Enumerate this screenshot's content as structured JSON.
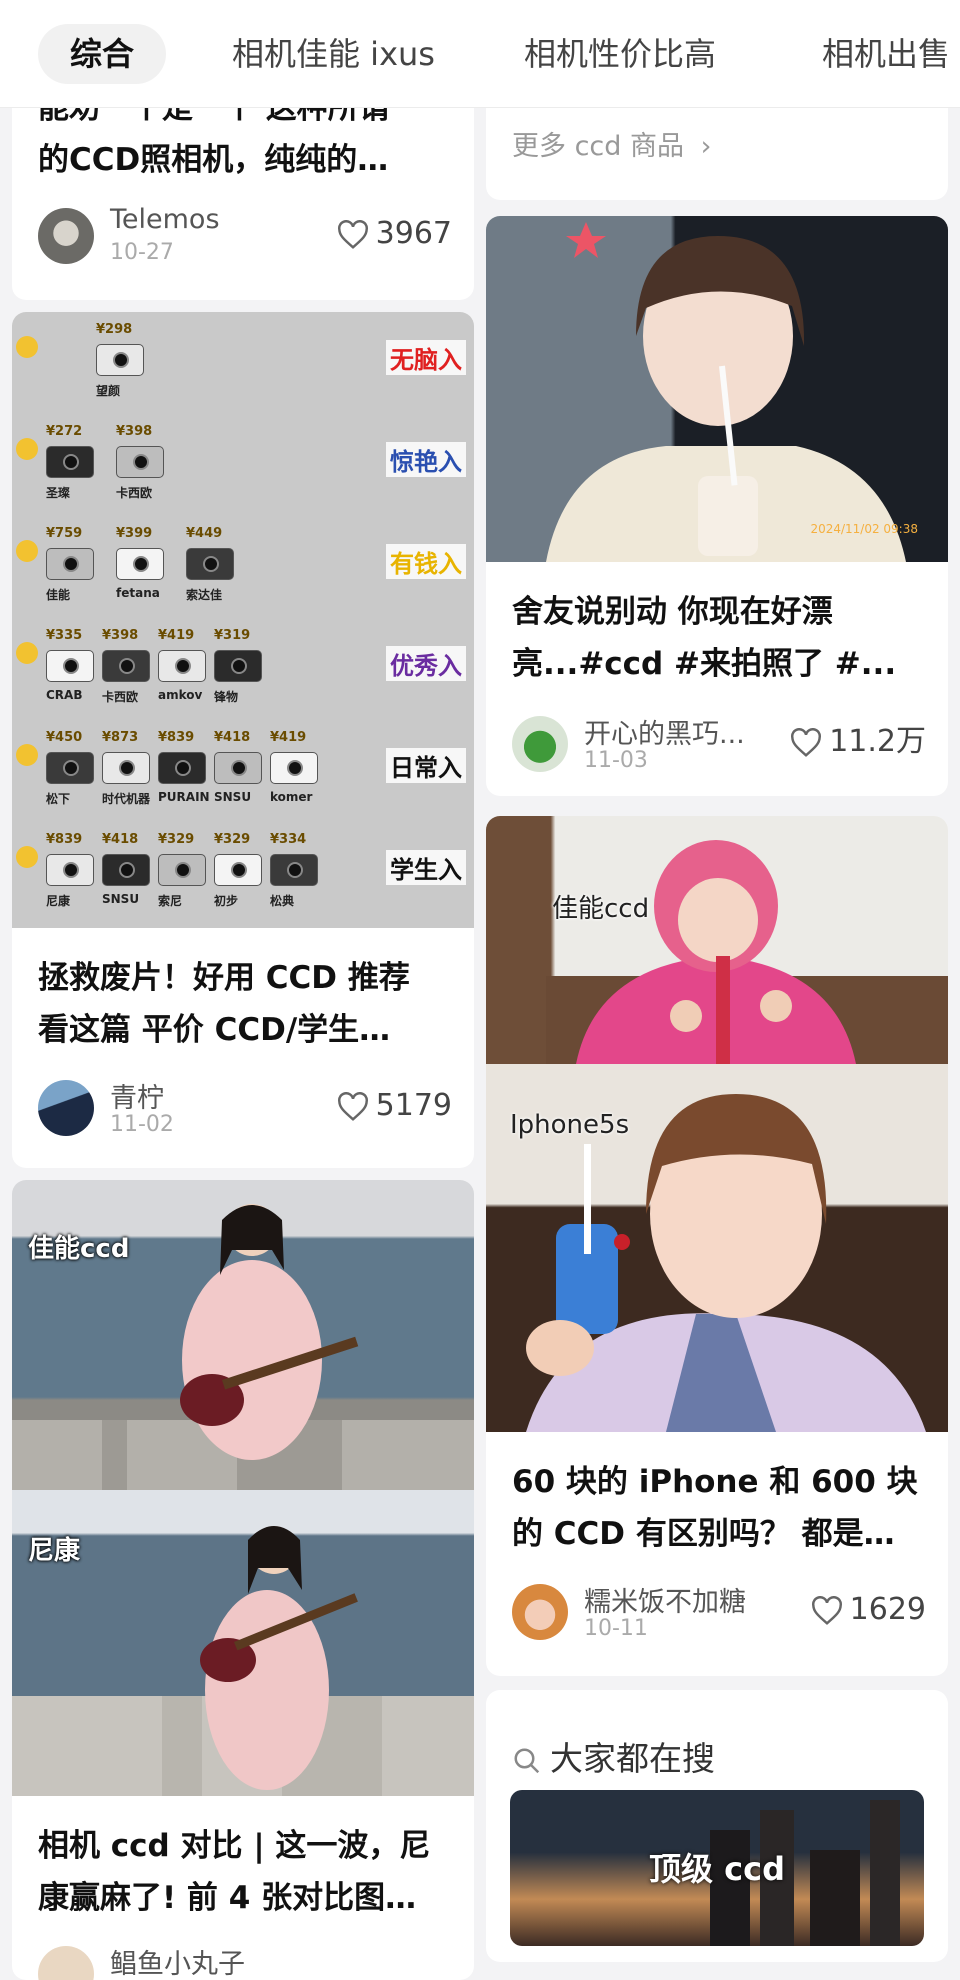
{
  "tabs": [
    "综合",
    "相机佳能 ixus",
    "相机性价比高",
    "相机出售"
  ],
  "left_column": {
    "card1": {
      "title_line1": "能劝一个是一个 这种所谓",
      "title_line2": "的CCD照相机，纯纯的…",
      "author": "Telemos",
      "date": "10-27",
      "likes": "3967"
    },
    "card2": {
      "tiers": [
        {
          "label": "无脑入",
          "color": "#e02020",
          "prices": [
            "298"
          ],
          "names": [
            "望颜"
          ]
        },
        {
          "label": "惊艳入",
          "color": "#2a4fb0",
          "prices": [
            "272",
            "398"
          ],
          "names": [
            "圣璨",
            "卡西欧"
          ]
        },
        {
          "label": "有钱入",
          "color": "#e8b400",
          "prices": [
            "759",
            "399",
            "449"
          ],
          "names": [
            "佳能",
            "fetana",
            "索达佳"
          ]
        },
        {
          "label": "优秀入",
          "color": "#6a2ca0",
          "prices": [
            "335",
            "398",
            "419",
            "319"
          ],
          "names": [
            "CRAB",
            "卡西欧",
            "amkov",
            "锋物"
          ]
        },
        {
          "label": "日常入",
          "color": "#111111",
          "prices": [
            "450",
            "873",
            "839",
            "418",
            "419"
          ],
          "names": [
            "松下",
            "时代机器",
            "PURAIN",
            "SNSU",
            "komer"
          ]
        },
        {
          "label": "学生入",
          "color": "#111111",
          "prices": [
            "839",
            "418",
            "329",
            "329",
            "334"
          ],
          "names": [
            "尼康",
            "SNSU",
            "索尼",
            "初步",
            "松典"
          ]
        }
      ],
      "title_line1": "拯救废片！好用 CCD 推荐",
      "title_line2": "看这篇 平价 CCD/学生…",
      "author": "青柠",
      "date": "11-02",
      "likes": "5179"
    },
    "card3": {
      "label_top": "佳能ccd",
      "label_bottom": "尼康",
      "title_line1": "相机 ccd 对比 | 这一波，尼",
      "title_line2": "康赢麻了! 前 4 张对比图…",
      "author": "鲳鱼小丸子"
    }
  },
  "right_column": {
    "more_link": "更多 ccd 商品",
    "card1": {
      "timestamp": "2024/11/02 09:38",
      "title_line1": "舍友说别动 你现在好漂",
      "title_line2": "亮...#ccd #来拍照了 #...",
      "author": "开心的黑巧...",
      "date": "11-03",
      "likes": "11.2万"
    },
    "card2": {
      "label_top": "佳能ccd",
      "label_bottom": "Iphone5s",
      "title_line1": "60 块的 iPhone 和 600 块",
      "title_line2": "的 CCD 有区别吗？ 都是…",
      "author": "糯米饭不加糖",
      "date": "10-11",
      "likes": "1629"
    },
    "search_block": {
      "heading": "大家都在搜",
      "suggestion": "顶级 ccd"
    }
  },
  "colors": {
    "accent": "#111111",
    "background": "#f3f3f5",
    "card": "#ffffff"
  }
}
